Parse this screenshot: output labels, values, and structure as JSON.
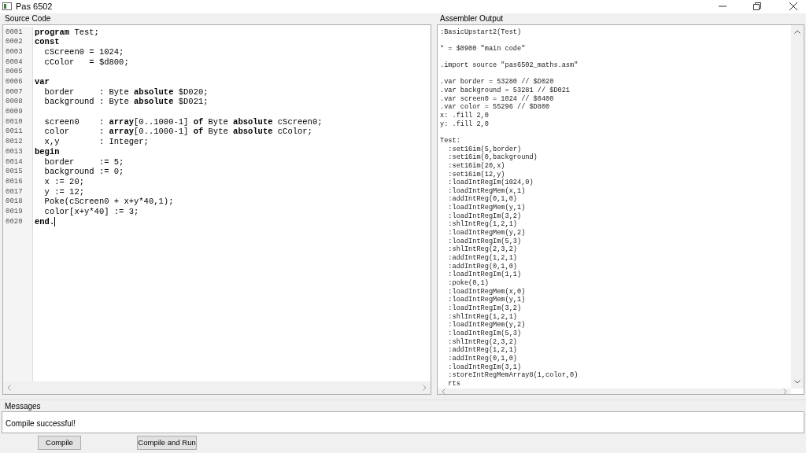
{
  "window": {
    "title": "Pas 6502"
  },
  "source": {
    "title": "Source Code",
    "lines": [
      {
        "num": "0001",
        "text": "**program** Test;"
      },
      {
        "num": "0002",
        "text": "**const**"
      },
      {
        "num": "0003",
        "text": "  cScreen0 = 1024;"
      },
      {
        "num": "0004",
        "text": "  cColor   = $d800;"
      },
      {
        "num": "0005"
      },
      {
        "num": "0006",
        "text": "**var**"
      },
      {
        "num": "0007",
        "text": "  border     : Byte **absolute** $D020;"
      },
      {
        "num": "0008",
        "text": "  background : Byte **absolute** $D021;"
      },
      {
        "num": "0009"
      },
      {
        "num": "0010",
        "text": "  screen0    : **array**[0..1000-1] **of** Byte **absolute** cScreen0;"
      },
      {
        "num": "0011",
        "text": "  color      : **array**[0..1000-1] **of** Byte **absolute** cColor;"
      },
      {
        "num": "0012",
        "text": "  x,y        : Integer;"
      },
      {
        "num": "0013",
        "text": "**begin**"
      },
      {
        "num": "0014",
        "text": "  border     := 5;"
      },
      {
        "num": "0015",
        "text": "  background := 0;"
      },
      {
        "num": "0016",
        "text": "  x := 20;"
      },
      {
        "num": "0017",
        "text": "  y := 12;"
      },
      {
        "num": "0018",
        "text": "  Poke(cScreen0 + x+y*40,1);"
      },
      {
        "num": "0019",
        "text": "  color[x+y*40] := 3;"
      },
      {
        "num": "0020",
        "text": "**end.**",
        "cursor": true
      }
    ]
  },
  "assembler": {
    "title": "Assembler Output",
    "blocks": [
      [
        ":BasicUpstart2(Test)"
      ],
      [
        "* = $0900 \"main code\""
      ],
      [
        ".import source \"pas6502_maths.asm\""
      ],
      [
        ".var border = 53280 // $D020",
        ".var background = 53281 // $D021",
        ".var screen0 = 1024 // $0400",
        ".var color = 55296 // $D800",
        "x: .fill 2,0",
        "y: .fill 2,0"
      ],
      [
        "Test:",
        "  :set16im(5,border)",
        "  :set16im(0,background)",
        "  :set16im(20,x)",
        "  :set16im(12,y)",
        "  :loadIntRegIm(1024,0)",
        "  :loadIntRegMem(x,1)",
        "  :addIntReg(0,1,0)",
        "  :loadIntRegMem(y,1)",
        "  :loadIntRegIm(3,2)",
        "  :shlIntReg(1,2,1)",
        "  :loadIntRegMem(y,2)",
        "  :loadIntRegIm(5,3)",
        "  :shlIntReg(2,3,2)",
        "  :addIntReg(1,2,1)",
        "  :addIntReg(0,1,0)",
        "  :loadIntRegIm(1,1)",
        "  :poke(0,1)",
        "  :loadIntRegMem(x,0)",
        "  :loadIntRegMem(y,1)",
        "  :loadIntRegIm(3,2)",
        "  :shlIntReg(1,2,1)",
        "  :loadIntRegMem(y,2)",
        "  :loadIntRegIm(5,3)",
        "  :shlIntReg(2,3,2)",
        "  :addIntReg(1,2,1)",
        "  :addIntReg(0,1,0)",
        "  :loadIntRegIm(3,1)",
        "  :storeIntRegMemArray8(1,color,0)",
        "  rts"
      ]
    ]
  },
  "messages": {
    "title": "Messages",
    "text": "Compile successful!"
  },
  "buttons": [
    "Compile",
    "Compile and Run"
  ]
}
